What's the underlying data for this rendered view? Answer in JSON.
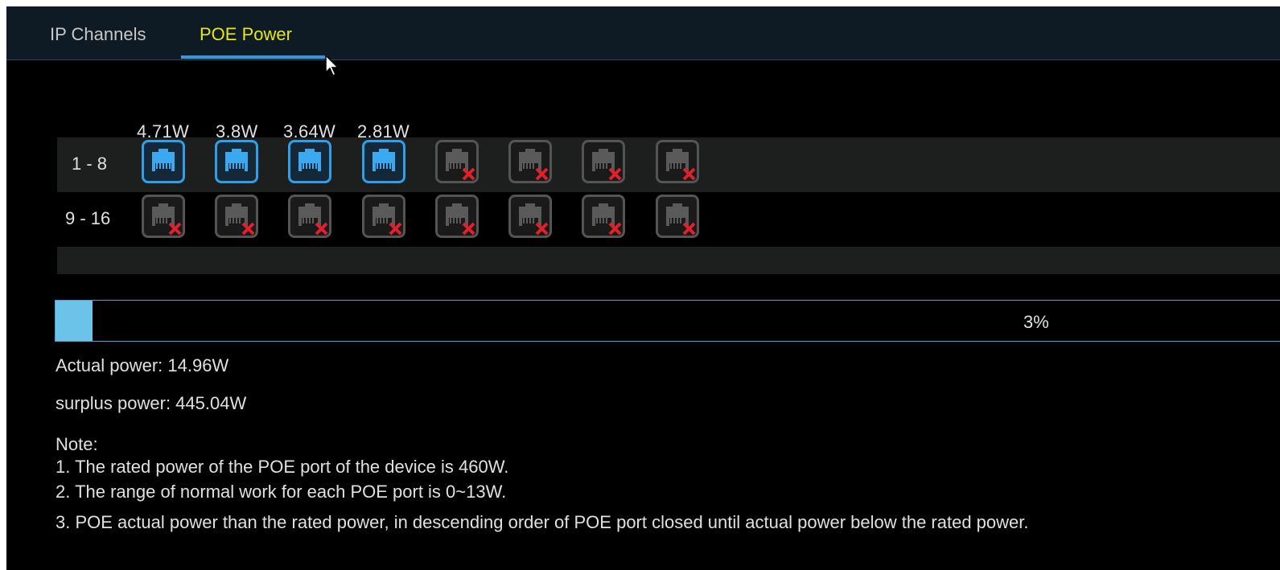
{
  "tabs": [
    {
      "label": "IP Channels",
      "active": false
    },
    {
      "label": "POE Power",
      "active": true
    }
  ],
  "poe": {
    "watts": [
      "4.71W",
      "3.8W",
      "3.64W",
      "2.81W"
    ],
    "rows": [
      {
        "label": "1 - 8",
        "ports": [
          "on",
          "on",
          "on",
          "on",
          "off",
          "off",
          "off",
          "off"
        ]
      },
      {
        "label": "9 - 16",
        "ports": [
          "off",
          "off",
          "off",
          "off",
          "off",
          "off",
          "off",
          "off"
        ]
      }
    ],
    "usage_percent": 3,
    "usage_text": "3%",
    "actual_power": "Actual power: 14.96W",
    "surplus_power": "surplus power: 445.04W"
  },
  "note": {
    "title": "Note:",
    "lines": [
      "1. The rated power of the POE port of the device is 460W.",
      "2. The range of normal work for each POE port is 0~13W.",
      "3. POE actual power than the rated power, in descending order of POE port closed until actual power below the rated power."
    ]
  },
  "colors": {
    "active_tab": "#e6e61a",
    "accent": "#2f9ae0",
    "port_off_x": "#e0202a",
    "progress_fill": "#6cc3ea"
  },
  "icons": {
    "port_active": "ethernet-port-icon",
    "port_inactive": "ethernet-port-disconnected-icon",
    "cursor": "mouse-pointer-icon"
  }
}
